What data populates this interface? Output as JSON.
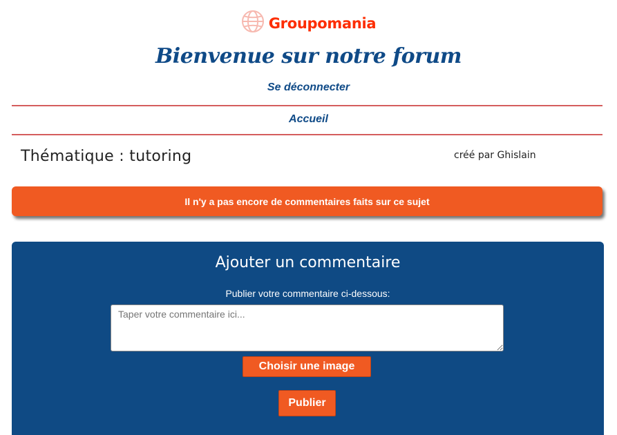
{
  "brand": {
    "name": "Groupomania",
    "color": "#fd2d01",
    "icon": "globe-icon"
  },
  "header": {
    "welcome": "Bienvenue sur notre forum",
    "logout_label": "Se déconnecter",
    "home_label": "Accueil"
  },
  "topic": {
    "theme_text": "Thématique : tutoring",
    "author_text": "créé par Ghislain"
  },
  "notice": {
    "text": "Il n'y a pas encore de commentaires faits sur ce sujet"
  },
  "comment_form": {
    "title": "Ajouter un commentaire",
    "label": "Publier votre commentaire ci-dessous:",
    "placeholder": "Taper votre commentaire ici...",
    "value": "",
    "choose_image_label": "Choisir une image",
    "publish_label": "Publier"
  },
  "colors": {
    "primary_blue": "#0f4a84",
    "accent_orange": "#f05a22",
    "divider_red": "#d45d5d"
  }
}
